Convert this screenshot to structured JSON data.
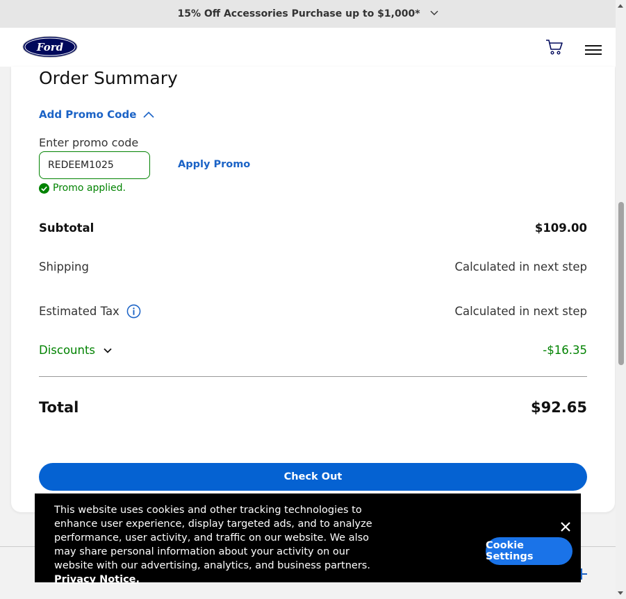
{
  "banner": {
    "text": "15% Off Accessories Purchase up to $1,000*"
  },
  "header": {
    "logo_text": "Ford"
  },
  "summary": {
    "title": "Order Summary",
    "add_promo_label": "Add Promo Code",
    "promo_field_label": "Enter promo code",
    "promo_value": "REDEEM1025",
    "apply_label": "Apply Promo",
    "promo_status": "Promo applied.",
    "subtotal_label": "Subtotal",
    "subtotal_value": "$109.00",
    "shipping_label": "Shipping",
    "shipping_value": "Calculated in next step",
    "tax_label": "Estimated Tax",
    "tax_value": "Calculated in next step",
    "discounts_label": "Discounts",
    "discounts_value": "-$16.35",
    "total_label": "Total",
    "total_value": "$92.65",
    "checkout_label": "Check Out"
  },
  "cookie": {
    "text": "This website uses cookies and other tracking technologies to enhance user experience, display targeted ads, and to analyze performance, user activity, and traffic on our website. We also may share personal information about your activity on our website with our advertising, analytics, and business partners.",
    "link_text": "Privacy Notice.",
    "settings_label": "Cookie Settings"
  },
  "colors": {
    "brand_blue": "#00095b",
    "accent_blue": "#0562d2",
    "success_green": "#008200"
  }
}
